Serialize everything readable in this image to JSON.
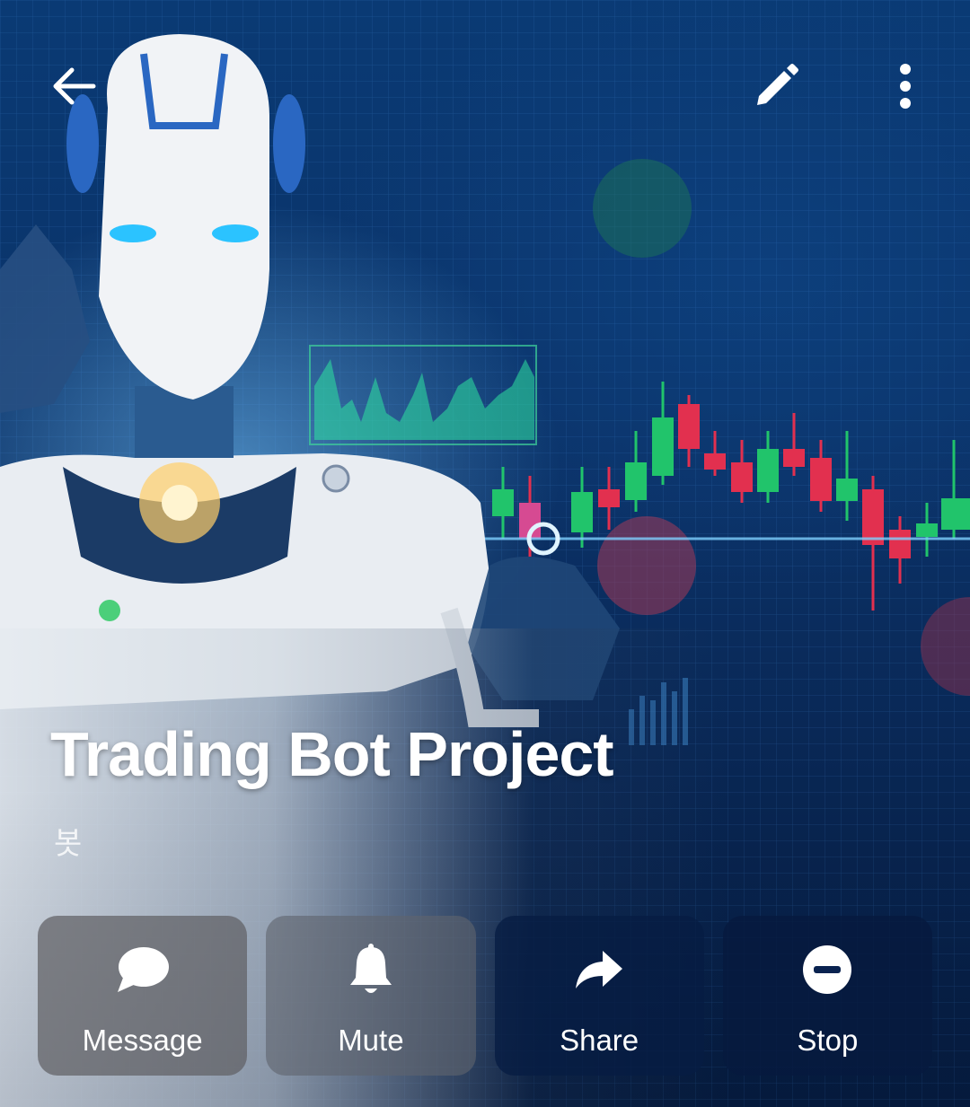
{
  "header": {
    "back_icon": "arrow-left-icon",
    "edit_icon": "pencil-icon",
    "more_icon": "more-vertical-icon"
  },
  "profile": {
    "title": "Trading Bot Project",
    "subtitle": "봇"
  },
  "actions": [
    {
      "label": "Message",
      "icon": "chat-bubble-icon"
    },
    {
      "label": "Mute",
      "icon": "bell-icon"
    },
    {
      "label": "Share",
      "icon": "share-arrow-icon"
    },
    {
      "label": "Stop",
      "icon": "minus-circle-icon"
    }
  ],
  "colors": {
    "background": "#0b3166",
    "candle_up": "#21c46b",
    "candle_down": "#e2304f",
    "text": "#ffffff"
  }
}
